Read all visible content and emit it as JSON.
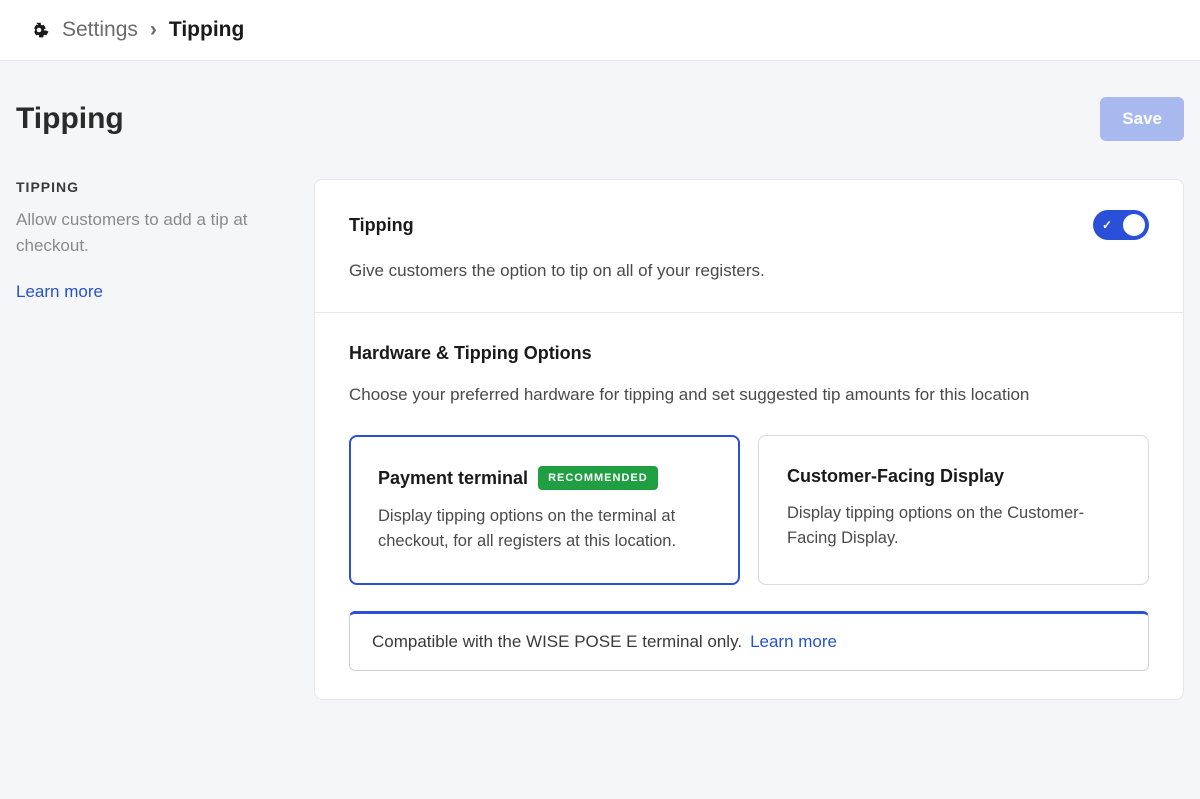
{
  "breadcrumb": {
    "root": "Settings",
    "current": "Tipping"
  },
  "page": {
    "title": "Tipping",
    "save_label": "Save"
  },
  "sidebar": {
    "heading": "Tipping",
    "description": "Allow customers to add a tip at checkout.",
    "learn_more": "Learn more"
  },
  "tipping_section": {
    "title": "Tipping",
    "description": "Give customers the option to tip on all of your registers.",
    "toggle_state": true
  },
  "hardware_section": {
    "title": "Hardware & Tipping Options",
    "description": "Choose your preferred hardware for tipping and set suggested tip amounts for this location",
    "options": [
      {
        "title": "Payment terminal",
        "badge": "Recommended",
        "description": "Display tipping options on the terminal at checkout, for all registers at this location.",
        "selected": true
      },
      {
        "title": "Customer-Facing Display",
        "badge": null,
        "description": "Display tipping options on the Customer-Facing Display.",
        "selected": false
      }
    ],
    "info": {
      "text": "Compatible with the WISE POSE E terminal only.",
      "link_label": "Learn more"
    }
  }
}
